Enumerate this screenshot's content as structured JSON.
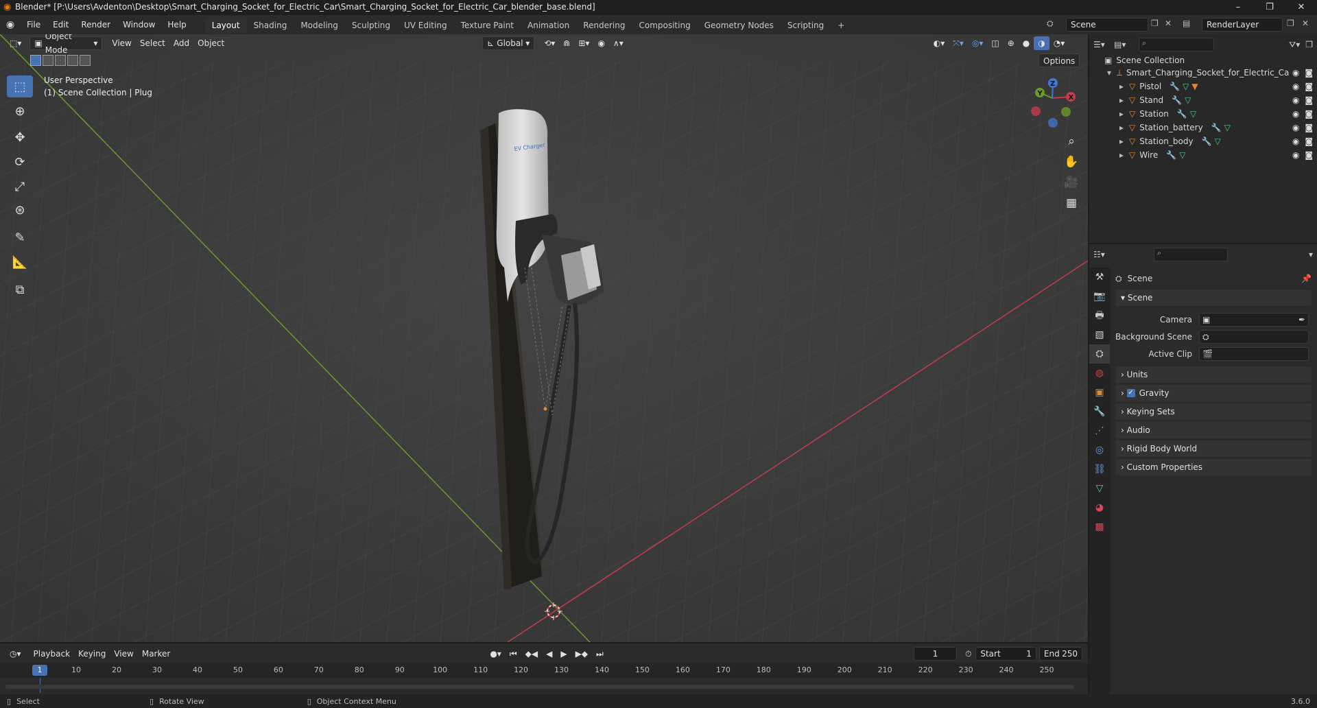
{
  "titlebar": {
    "title": "Blender* [P:\\Users\\Avdenton\\Desktop\\Smart_Charging_Socket_for_Electric_Car\\Smart_Charging_Socket_for_Electric_Car_blender_base.blend]",
    "minimize": "–",
    "maximize": "❐",
    "close": "✕"
  },
  "menu": [
    "File",
    "Edit",
    "Render",
    "Window",
    "Help"
  ],
  "workspaces": [
    "Layout",
    "Shading",
    "Modeling",
    "Sculpting",
    "UV Editing",
    "Texture Paint",
    "Animation",
    "Rendering",
    "Compositing",
    "Geometry Nodes",
    "Scripting"
  ],
  "workspace_add": "+",
  "scene_field": "Scene",
  "renderlayer_field": "RenderLayer",
  "viewport": {
    "mode": "Object Mode",
    "menus": [
      "View",
      "Select",
      "Add",
      "Object"
    ],
    "transform": "Global",
    "options": "Options",
    "perspective": "User Perspective",
    "collection_info": "(1) Scene Collection | Plug",
    "gizmo": {
      "x": "X",
      "y": "Y",
      "z": "Z"
    }
  },
  "outliner": {
    "root": "Scene Collection",
    "collection": "Smart_Charging_Socket_for_Electric_Ca",
    "objects": [
      "Pistol",
      "Stand",
      "Station",
      "Station_battery",
      "Station_body",
      "Wire"
    ]
  },
  "properties": {
    "header": "Scene",
    "section": "Scene",
    "fields": [
      {
        "label": "Camera"
      },
      {
        "label": "Background Scene"
      },
      {
        "label": "Active Clip"
      }
    ],
    "panels": [
      "Units",
      "Gravity",
      "Keying Sets",
      "Audio",
      "Rigid Body World",
      "Custom Properties"
    ]
  },
  "timeline": {
    "menus": [
      "Playback",
      "Keying",
      "View",
      "Marker"
    ],
    "current_frame": "1",
    "start_label": "Start",
    "start": "1",
    "end_label": "End",
    "end": "250",
    "ticks": [
      "1",
      "10",
      "20",
      "30",
      "40",
      "50",
      "60",
      "70",
      "80",
      "90",
      "100",
      "110",
      "120",
      "130",
      "140",
      "150",
      "160",
      "170",
      "180",
      "190",
      "200",
      "210",
      "220",
      "230",
      "240",
      "250"
    ]
  },
  "status": {
    "select": "Select",
    "rotate": "Rotate View",
    "context": "Object Context Menu",
    "version": "3.6.0"
  },
  "colors": {
    "accent": "#4772b3",
    "x_axis": "#c43c4c",
    "y_axis": "#6a9a2a",
    "z_axis": "#3d7bd8",
    "orange": "#e08a2e"
  }
}
